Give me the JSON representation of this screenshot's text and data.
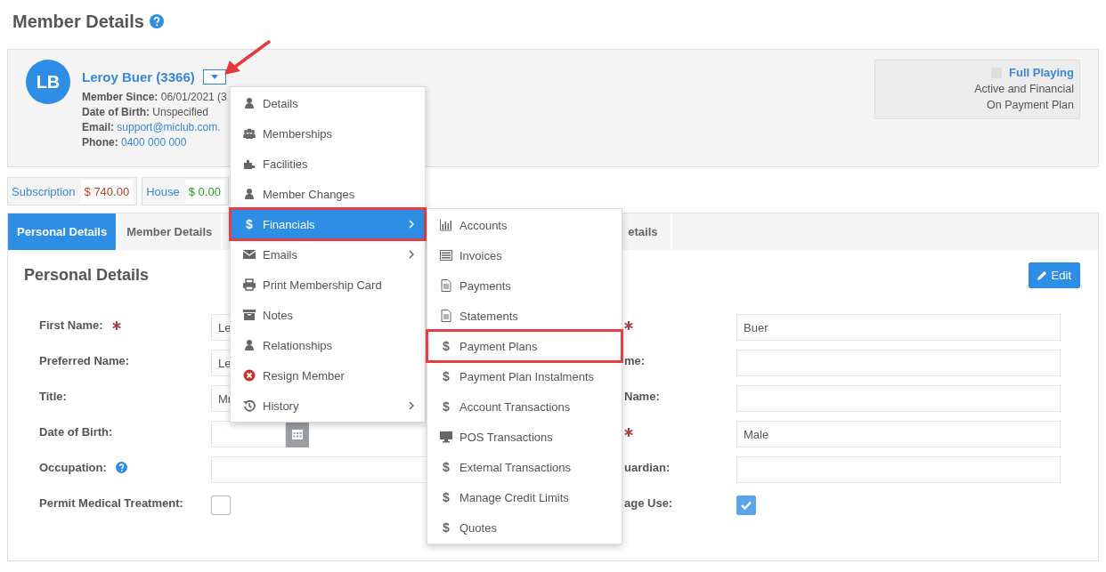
{
  "page": {
    "title": "Member Details"
  },
  "member": {
    "initials": "LB",
    "name": "Leroy Buer (3366)",
    "info": [
      {
        "label": "Member Since:",
        "value": "06/01/2021 (3",
        "kind": "text"
      },
      {
        "label": "Date of Birth:",
        "value": "Unspecified",
        "kind": "text"
      },
      {
        "label": "Email:",
        "value": "support@miclub.com.",
        "kind": "link"
      },
      {
        "label": "Phone:",
        "value": "0400 000 000",
        "kind": "link"
      }
    ],
    "status": {
      "checked": false,
      "title": "Full Playing",
      "lines": [
        "Active and Financial",
        "On Payment Plan"
      ]
    }
  },
  "balances": [
    {
      "label": "Subscription",
      "amount": "$ 740.00",
      "color": "#c0392b"
    },
    {
      "label": "House",
      "amount": "$ 0.00",
      "color": "#22a722"
    }
  ],
  "tabs": [
    {
      "label": "Personal Details",
      "selected": true
    },
    {
      "label": "Member Details",
      "selected": false
    },
    {
      "label": "etails",
      "selected": false
    }
  ],
  "section": {
    "title": "Personal Details",
    "edit_button": "Edit"
  },
  "form_left": [
    {
      "label": "First Name:",
      "required": true,
      "help": false,
      "kind": "text",
      "value": "Le"
    },
    {
      "label": "Preferred Name:",
      "required": false,
      "help": false,
      "kind": "text",
      "value": "Le"
    },
    {
      "label": "Title:",
      "required": false,
      "help": false,
      "kind": "text",
      "value": "Mr"
    },
    {
      "label": "Date of Birth:",
      "required": false,
      "help": false,
      "kind": "date"
    },
    {
      "label": "Occupation:",
      "required": false,
      "help": true,
      "kind": "text"
    },
    {
      "label": "Permit Medical Treatment:",
      "required": false,
      "help": false,
      "kind": "checkbox",
      "checked": false
    }
  ],
  "form_right": [
    {
      "required": true,
      "kind": "text",
      "value": "Buer"
    },
    {
      "label": "me:",
      "required": false,
      "kind": "text"
    },
    {
      "label": "Name:",
      "required": false,
      "kind": "text"
    },
    {
      "required": true,
      "kind": "text",
      "value": "Male"
    },
    {
      "label": "uardian:",
      "required": false,
      "kind": "text"
    },
    {
      "label": "age Use:",
      "required": false,
      "kind": "checkbox",
      "checked": true
    }
  ],
  "actions_menu": {
    "items": [
      {
        "label": "Details",
        "selected": false,
        "highlighted": false,
        "submenu": false
      },
      {
        "label": "Memberships",
        "selected": false,
        "highlighted": false,
        "submenu": false
      },
      {
        "label": "Facilities",
        "selected": false,
        "highlighted": false,
        "submenu": false
      },
      {
        "label": "Member Changes",
        "selected": false,
        "highlighted": false,
        "submenu": false
      },
      {
        "label": "Financials",
        "glyph": "$",
        "selected": true,
        "highlighted": true,
        "submenu": true
      },
      {
        "label": "Emails",
        "selected": false,
        "highlighted": false,
        "submenu": true
      },
      {
        "label": "Print Membership Card",
        "selected": false,
        "highlighted": false,
        "submenu": false
      },
      {
        "label": "Notes",
        "selected": false,
        "highlighted": false,
        "submenu": false
      },
      {
        "label": "Relationships",
        "selected": false,
        "highlighted": false,
        "submenu": false
      },
      {
        "label": "Resign Member",
        "selected": false,
        "highlighted": false,
        "submenu": false
      },
      {
        "label": "History",
        "selected": false,
        "highlighted": false,
        "submenu": true
      }
    ]
  },
  "financials_submenu": {
    "items": [
      {
        "label": "Accounts",
        "selected": false,
        "highlighted": false
      },
      {
        "label": "Invoices",
        "selected": false,
        "highlighted": false
      },
      {
        "label": "Payments",
        "selected": false,
        "highlighted": false
      },
      {
        "label": "Statements",
        "selected": false,
        "highlighted": false
      },
      {
        "label": "Payment Plans",
        "glyph": "$",
        "selected": false,
        "highlighted": true
      },
      {
        "label": "Payment Plan Instalments",
        "glyph": "$",
        "selected": false,
        "highlighted": false
      },
      {
        "label": "Account Transactions",
        "glyph": "$",
        "selected": false,
        "highlighted": false
      },
      {
        "label": "POS Transactions",
        "selected": false,
        "highlighted": false
      },
      {
        "label": "External Transactions",
        "glyph": "$",
        "selected": false,
        "highlighted": false
      },
      {
        "label": "Manage Credit Limits",
        "glyph": "$",
        "selected": false,
        "highlighted": false
      },
      {
        "label": "Quotes",
        "glyph": "$",
        "selected": false,
        "highlighted": false
      }
    ]
  },
  "annotations": [
    {
      "kind": "arrow"
    }
  ]
}
